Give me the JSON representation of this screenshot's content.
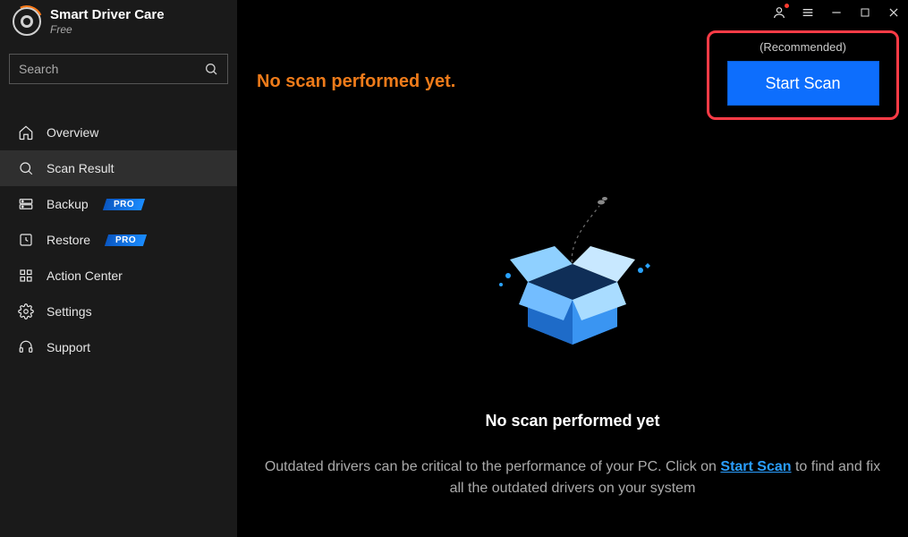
{
  "app": {
    "name": "Smart Driver Care",
    "edition": "Free"
  },
  "search": {
    "placeholder": "Search"
  },
  "nav": {
    "overview": "Overview",
    "scan_result": "Scan Result",
    "backup": "Backup",
    "restore": "Restore",
    "action_center": "Action Center",
    "settings": "Settings",
    "support": "Support",
    "pro_badge": "PRO"
  },
  "main": {
    "status": "No scan performed yet.",
    "cta_header": "(Recommended)",
    "cta_button": "Start Scan",
    "empty_title": "No scan performed yet",
    "desc_prefix": "Outdated drivers can be critical to the performance of your PC. Click on ",
    "desc_link": "Start Scan",
    "desc_suffix": " to find and fix all the outdated drivers on your system"
  },
  "colors": {
    "accent_orange": "#ee7b1a",
    "accent_blue": "#0d6efd",
    "highlight_red": "#ff3b46"
  }
}
